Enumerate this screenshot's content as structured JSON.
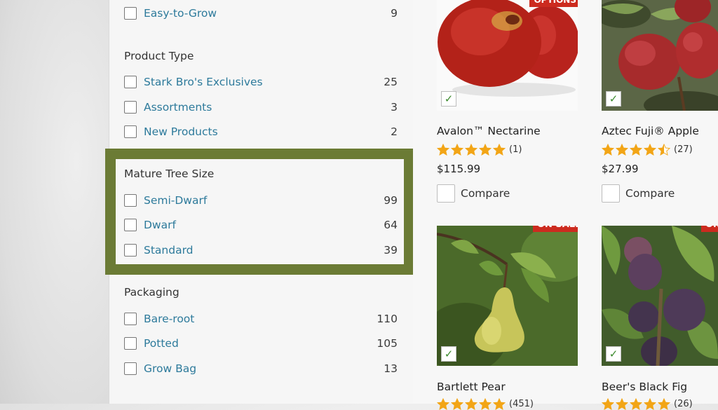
{
  "filters": {
    "easy_to_grow": {
      "label": "Easy-to-Grow",
      "count": "9"
    },
    "product_type": {
      "heading": "Product Type",
      "items": [
        {
          "label": "Stark Bro's Exclusives",
          "count": "25"
        },
        {
          "label": "Assortments",
          "count": "3"
        },
        {
          "label": "New Products",
          "count": "2"
        }
      ]
    },
    "mature_tree_size": {
      "heading": "Mature Tree Size",
      "items": [
        {
          "label": "Semi-Dwarf",
          "count": "99"
        },
        {
          "label": "Dwarf",
          "count": "64"
        },
        {
          "label": "Standard",
          "count": "39"
        }
      ]
    },
    "packaging": {
      "heading": "Packaging",
      "items": [
        {
          "label": "Bare-root",
          "count": "110"
        },
        {
          "label": "Potted",
          "count": "105"
        },
        {
          "label": "Grow Bag",
          "count": "13"
        }
      ]
    }
  },
  "products": [
    {
      "name": "Avalon™ Nectarine",
      "rating": 5,
      "reviews": "(1)",
      "price": "$115.99",
      "compare_label": "Compare",
      "badge": "OPTIONS",
      "selected": true
    },
    {
      "name": "Aztec Fuji® Apple",
      "rating": 4.5,
      "reviews": "(27)",
      "price": "$27.99",
      "compare_label": "Compare",
      "selected": true
    },
    {
      "name": "Bartlett Pear",
      "rating": 5,
      "reviews": "(451)",
      "badge": "ON SALE",
      "selected": true
    },
    {
      "name": "Beer's Black Fig",
      "rating": 5,
      "reviews": "(26)",
      "badge": "ON SALE",
      "selected": true
    }
  ],
  "colors": {
    "link": "#2d7a9b",
    "highlight_border": "#6b7b35",
    "sale_badge": "#cc2b1f",
    "star": "#f2a516",
    "checkmark": "#3b8a2c"
  }
}
